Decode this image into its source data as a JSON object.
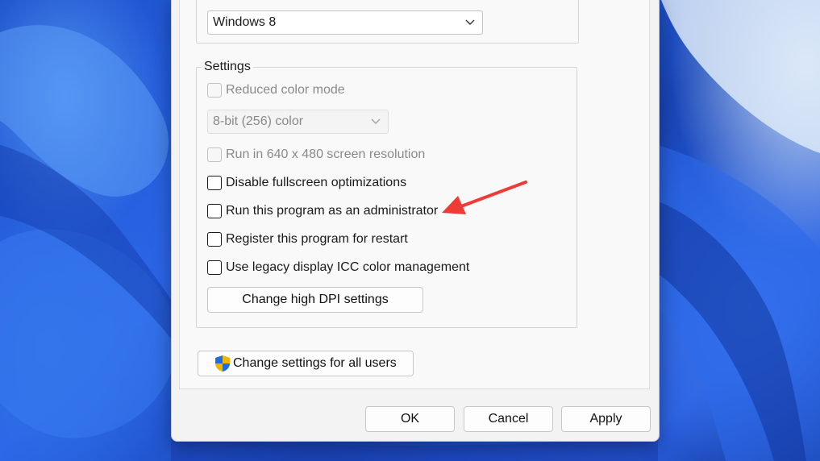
{
  "compatibility_mode": {
    "selected_os": "Windows 8"
  },
  "settings": {
    "legend": "Settings",
    "reduced_color": {
      "label": "Reduced color mode",
      "checked": false,
      "enabled": false
    },
    "color_depth": {
      "selected": "8-bit (256) color",
      "enabled": false
    },
    "low_resolution": {
      "label": "Run in 640 x 480 screen resolution",
      "checked": false,
      "enabled": false
    },
    "disable_fullscreen": {
      "label": "Disable fullscreen optimizations",
      "checked": false,
      "enabled": true
    },
    "run_as_admin": {
      "label": "Run this program as an administrator",
      "checked": false,
      "enabled": true
    },
    "register_restart": {
      "label": "Register this program for restart",
      "checked": false,
      "enabled": true
    },
    "legacy_icc": {
      "label": "Use legacy display ICC color management",
      "checked": false,
      "enabled": true
    },
    "dpi_button": "Change high DPI settings"
  },
  "all_users_button": "Change settings for all users",
  "footer": {
    "ok": "OK",
    "cancel": "Cancel",
    "apply": "Apply"
  },
  "annotation": {
    "arrow_color": "#ef3b36"
  }
}
